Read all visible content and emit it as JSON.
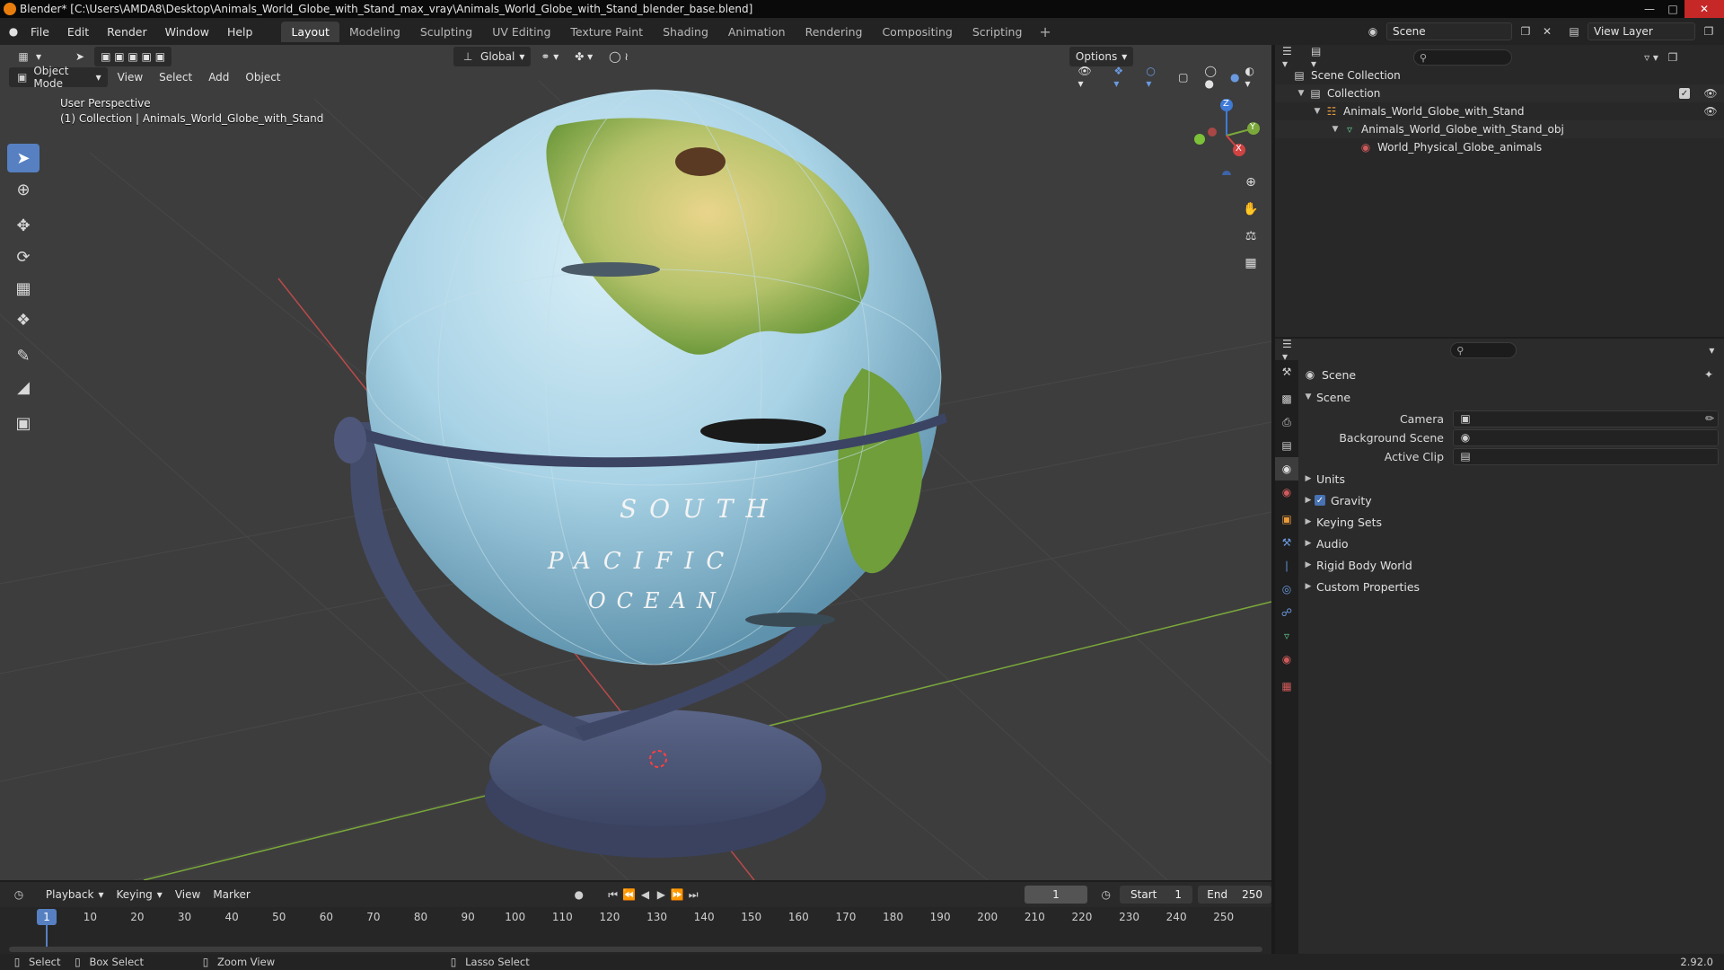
{
  "window": {
    "title": "Blender* [C:\\Users\\AMDA8\\Desktop\\Animals_World_Globe_with_Stand_max_vray\\Animals_World_Globe_with_Stand_blender_base.blend]"
  },
  "menu": [
    "File",
    "Edit",
    "Render",
    "Window",
    "Help"
  ],
  "workspaces": [
    "Layout",
    "Modeling",
    "Sculpting",
    "UV Editing",
    "Texture Paint",
    "Shading",
    "Animation",
    "Rendering",
    "Compositing",
    "Scripting"
  ],
  "active_workspace": "Layout",
  "scene_selector": {
    "scene": "Scene",
    "view_layer": "View Layer"
  },
  "viewport": {
    "mode": "Object Mode",
    "menus": [
      "View",
      "Select",
      "Add",
      "Object"
    ],
    "transform_orientation": "Global",
    "options_label": "Options",
    "overlay_line1": "User Perspective",
    "overlay_line2": "(1) Collection | Animals_World_Globe_with_Stand",
    "globe_text": [
      "SOUTH",
      "PACIFIC",
      "OCEAN"
    ],
    "gizmo_axes": [
      "X",
      "Y",
      "Z"
    ]
  },
  "timeline": {
    "menus": [
      "Playback",
      "Keying",
      "View",
      "Marker"
    ],
    "current_frame": "1",
    "start_label": "Start",
    "start": "1",
    "end_label": "End",
    "end": "250",
    "ruler_ticks": [
      "1",
      "10",
      "20",
      "30",
      "40",
      "50",
      "60",
      "70",
      "80",
      "90",
      "100",
      "110",
      "120",
      "130",
      "140",
      "150",
      "160",
      "170",
      "180",
      "190",
      "200",
      "210",
      "220",
      "230",
      "240",
      "250"
    ]
  },
  "statusbar": {
    "select": "Select",
    "box_select": "Box Select",
    "zoom_view": "Zoom View",
    "lasso_select": "Lasso Select",
    "version": "2.92.0"
  },
  "outliner": {
    "rows": [
      {
        "label": "Scene Collection"
      },
      {
        "label": "Collection"
      },
      {
        "label": "Animals_World_Globe_with_Stand"
      },
      {
        "label": "Animals_World_Globe_with_Stand_obj"
      },
      {
        "label": "World_Physical_Globe_animals"
      }
    ]
  },
  "properties": {
    "context": "Scene",
    "panel": "Scene",
    "fields": [
      {
        "label": "Camera"
      },
      {
        "label": "Background Scene"
      },
      {
        "label": "Active Clip"
      }
    ],
    "subpanels": [
      "Units",
      "Gravity",
      "Keying Sets",
      "Audio",
      "Rigid Body World",
      "Custom Properties"
    ]
  },
  "colors": {
    "accent": "#5680c2",
    "viewport_bg": "#3d3d3d",
    "grid": "#474747",
    "axis_x": "#b94a4a",
    "axis_y": "#7aa83a",
    "globe_ocean": "#a9d3e6",
    "stand": "#4a5475"
  }
}
